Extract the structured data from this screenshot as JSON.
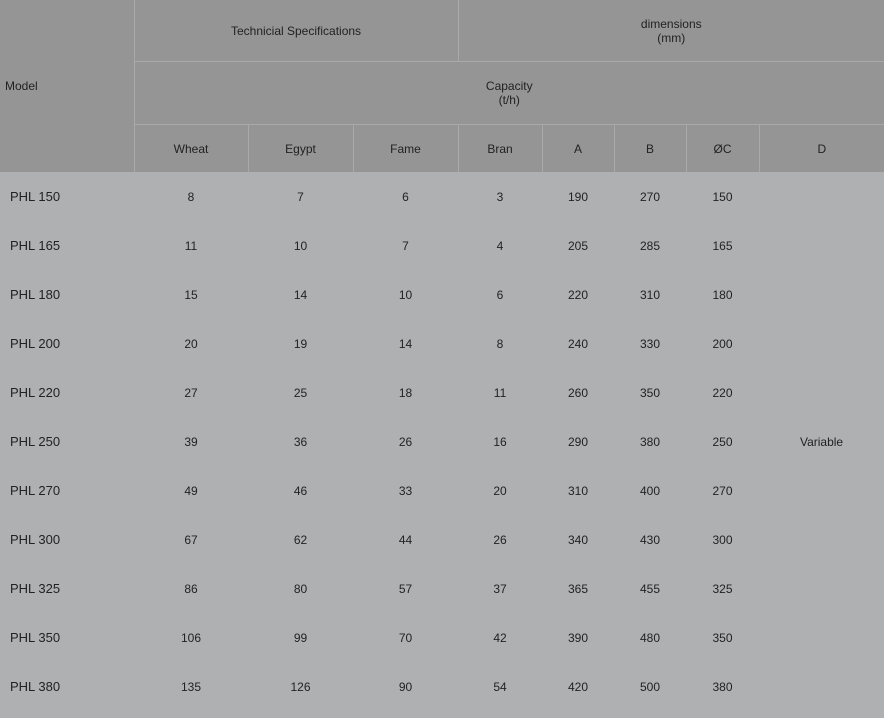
{
  "header": {
    "model": "Model",
    "tech_specs": "Technicial Specifications",
    "dimensions_line1": "dimensions",
    "dimensions_line2": "(mm)",
    "capacity_line1": "Capacity",
    "capacity_line2": "(t/h)",
    "columns": [
      "Wheat",
      "Egypt",
      "Fame",
      "Bran",
      "A",
      "B",
      "ØC",
      "D"
    ]
  },
  "variable_label": "Variable",
  "rows": [
    [
      "PHL 150",
      "8",
      "7",
      "6",
      "3",
      "190",
      "270",
      "150"
    ],
    [
      "PHL 165",
      "11",
      "10",
      "7",
      "4",
      "205",
      "285",
      "165"
    ],
    [
      "PHL 180",
      "15",
      "14",
      "10",
      "6",
      "220",
      "310",
      "180"
    ],
    [
      "PHL 200",
      "20",
      "19",
      "14",
      "8",
      "240",
      "330",
      "200"
    ],
    [
      "PHL 220",
      "27",
      "25",
      "18",
      "11",
      "260",
      "350",
      "220"
    ],
    [
      "PHL 250",
      "39",
      "36",
      "26",
      "16",
      "290",
      "380",
      "250"
    ],
    [
      "PHL 270",
      "49",
      "46",
      "33",
      "20",
      "310",
      "400",
      "270"
    ],
    [
      "PHL 300",
      "67",
      "62",
      "44",
      "26",
      "340",
      "430",
      "300"
    ],
    [
      "PHL 325",
      "86",
      "80",
      "57",
      "37",
      "365",
      "455",
      "325"
    ],
    [
      "PHL 350",
      "106",
      "99",
      "70",
      "42",
      "390",
      "480",
      "350"
    ],
    [
      "PHL 380",
      "135",
      "126",
      "90",
      "54",
      "420",
      "500",
      "380"
    ]
  ],
  "colors": {
    "header_bg": "#959595",
    "body_bg": "#afb0b1",
    "divider": "#a9a9a9"
  }
}
